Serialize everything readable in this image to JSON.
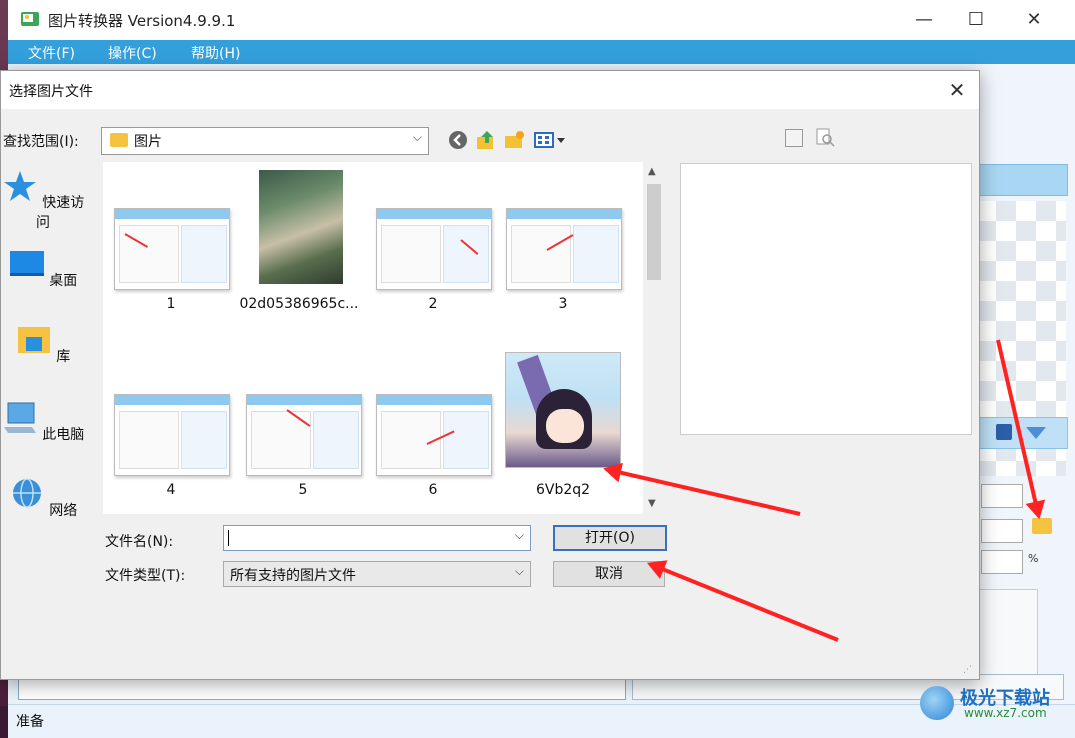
{
  "app": {
    "title": "图片转换器 Version4.9.9.1",
    "minimize": "—",
    "maximize": "☐",
    "close": "✕"
  },
  "menu": [
    {
      "label": "文件(F)"
    },
    {
      "label": "操作(C)"
    },
    {
      "label": "帮助(H)"
    }
  ],
  "status": {
    "text": "准备"
  },
  "dialog": {
    "title": "选择图片文件",
    "close": "✕",
    "lookin_label": "查找范围(I):",
    "lookin_value": "图片",
    "places": [
      {
        "label": "快速访问",
        "icon": "star-icon"
      },
      {
        "label": "桌面",
        "icon": "desktop-icon"
      },
      {
        "label": "库",
        "icon": "library-icon"
      },
      {
        "label": "此电脑",
        "icon": "computer-icon"
      },
      {
        "label": "网络",
        "icon": "network-icon"
      }
    ],
    "files": [
      {
        "name": "1"
      },
      {
        "name": "02d05386965c..."
      },
      {
        "name": "2"
      },
      {
        "name": "3"
      },
      {
        "name": "4"
      },
      {
        "name": "5"
      },
      {
        "name": "6"
      },
      {
        "name": "6Vb2q2"
      }
    ],
    "filename_label": "文件名(N):",
    "filename_value": "",
    "filetype_label": "文件类型(T):",
    "filetype_value": "所有支持的图片文件",
    "open_button": "打开(O)",
    "cancel_button": "取消"
  },
  "watermark": {
    "text": "极光下载站",
    "url": "www.xz7.com"
  },
  "colors": {
    "accent": "#33a0dc",
    "annotation_red": "#f22222"
  }
}
